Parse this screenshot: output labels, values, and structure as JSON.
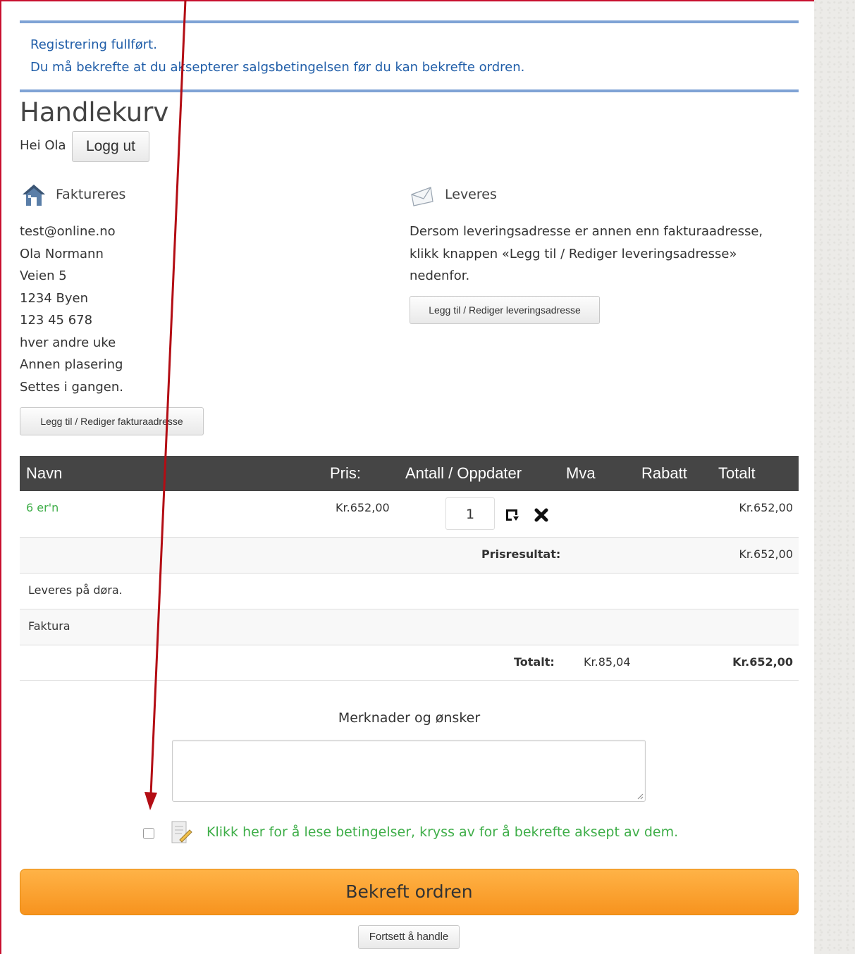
{
  "notice": {
    "line1": "Registrering fullført.",
    "line2": "Du må bekrefte at du aksepterer salgsbetingelsen før du kan bekrefte ordren."
  },
  "page_title": "Handlekurv",
  "greeting": "Hei Ola",
  "logout_label": "Logg ut",
  "billing": {
    "heading": "Faktureres",
    "lines": [
      "test@online.no",
      "Ola Normann",
      "Veien 5",
      "1234 Byen",
      "123 45 678",
      "hver andre uke",
      "Annen plasering",
      "Settes i gangen."
    ],
    "edit_button": "Legg til / Rediger fakturaadresse"
  },
  "delivery": {
    "heading": "Leveres",
    "text": "Dersom leveringsadresse er annen enn fakturaadresse, klikk knappen «Legg til / Rediger leveringsadresse» nedenfor.",
    "edit_button": "Legg til / Rediger leveringsadresse"
  },
  "table": {
    "headers": {
      "name": "Navn",
      "price": "Pris:",
      "qty": "Antall / Oppdater",
      "vat": "Mva",
      "discount": "Rabatt",
      "total": "Totalt"
    },
    "item": {
      "name": "6 er'n",
      "price": "Kr.652,00",
      "qty": "1",
      "total": "Kr.652,00"
    },
    "subtotal_label": "Prisresultat:",
    "subtotal_value": "Kr.652,00",
    "shipping": "Leveres på døra.",
    "payment": "Faktura",
    "total_label": "Totalt:",
    "total_vat": "Kr.85,04",
    "total_value": "Kr.652,00"
  },
  "notes_label": "Merknader og ønsker",
  "terms_text": "Klikk her for å lese betingelser, kryss av for å bekrefte aksept av dem.",
  "confirm_label": "Bekreft ordren",
  "continue_label": "Fortsett å handle",
  "colors": {
    "notice_border": "#7fa3d5",
    "notice_text": "#1f5da8",
    "link_green": "#3fae49",
    "confirm_orange": "#f7931e",
    "arrow_red": "#b30d14"
  }
}
